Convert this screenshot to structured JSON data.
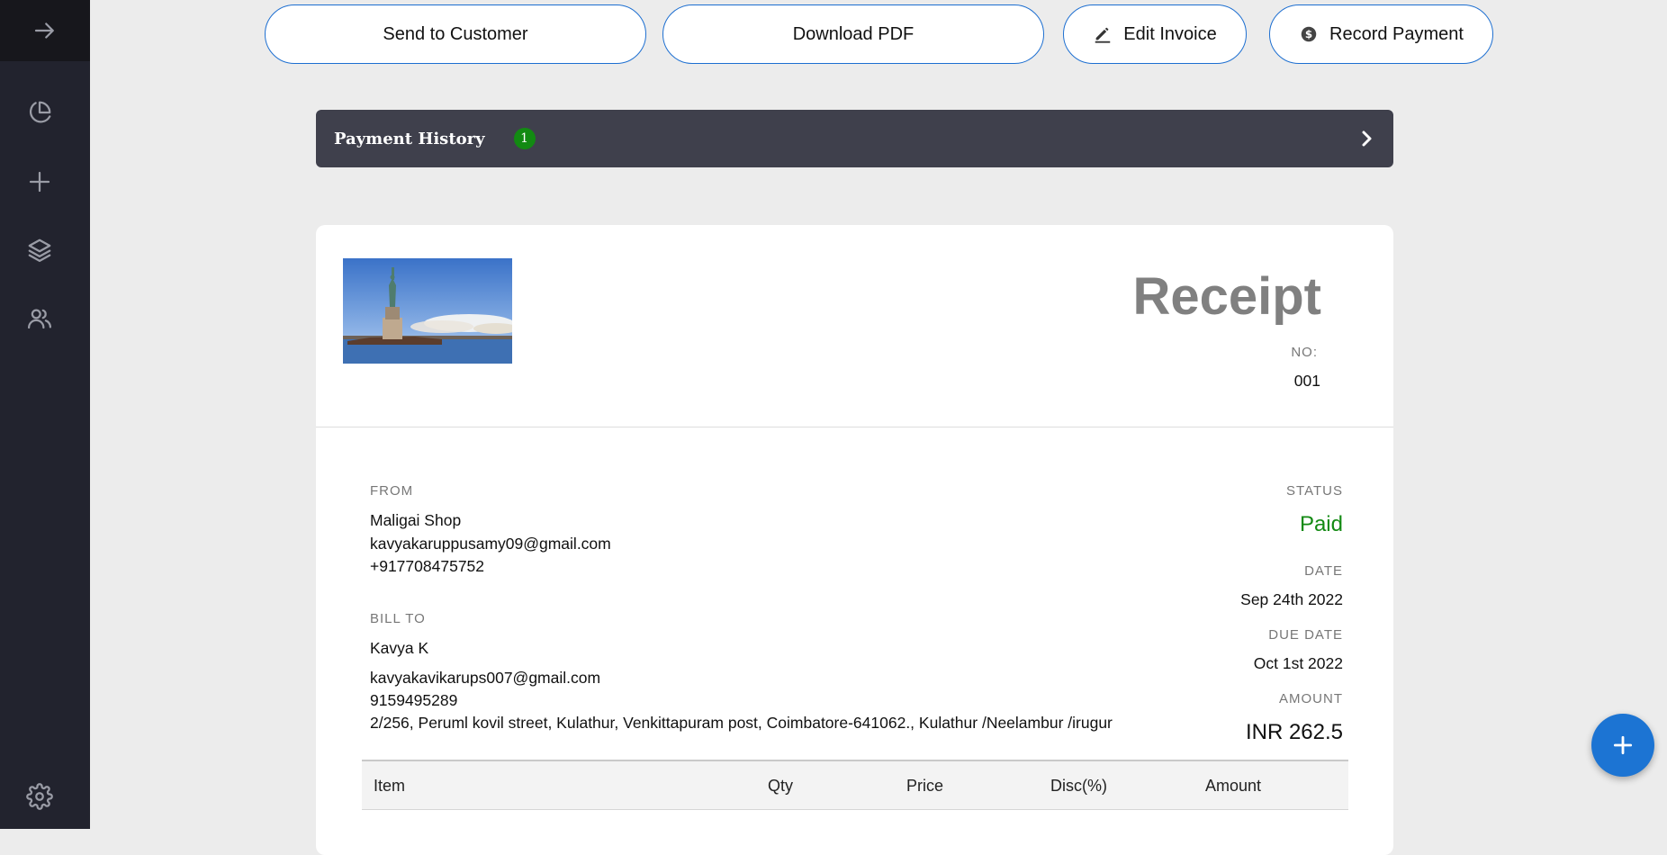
{
  "sidebar": {
    "icons": [
      "arrow-right-icon",
      "pie-chart-icon",
      "plus-icon",
      "layers-icon",
      "users-icon",
      "gear-icon"
    ]
  },
  "actions": {
    "send_label": "Send to Customer",
    "download_label": "Download PDF",
    "edit_label": "Edit Invoice",
    "record_label": "Record Payment"
  },
  "payment_history": {
    "title": "Payment History",
    "count": "1"
  },
  "receipt": {
    "title": "Receipt",
    "no_label": "NO:",
    "no_value": "001",
    "from": {
      "label": "FROM",
      "name": "Maligai Shop",
      "email": "kavyakaruppusamy09@gmail.com",
      "phone": "+917708475752"
    },
    "bill_to": {
      "label": "BILL TO",
      "name": "Kavya K",
      "email": "kavyakavikarups007@gmail.com",
      "phone": "9159495289",
      "address": "2/256, Peruml kovil street, Kulathur, Venkittapuram post, Coimbatore-641062., Kulathur /Neelambur /irugur"
    },
    "status": {
      "label": "STATUS",
      "value": "Paid",
      "color": "#138a13"
    },
    "date": {
      "label": "DATE",
      "value": "Sep 24th 2022"
    },
    "due_date": {
      "label": "DUE DATE",
      "value": "Oct 1st 2022"
    },
    "amount": {
      "label": "AMOUNT",
      "value": "INR 262.5"
    }
  },
  "table": {
    "headers": [
      "Item",
      "Qty",
      "Price",
      "Disc(%)",
      "Amount"
    ]
  },
  "colors": {
    "accent": "#1c74d3",
    "sidebar": "#22232e",
    "bar": "#3f404c"
  }
}
